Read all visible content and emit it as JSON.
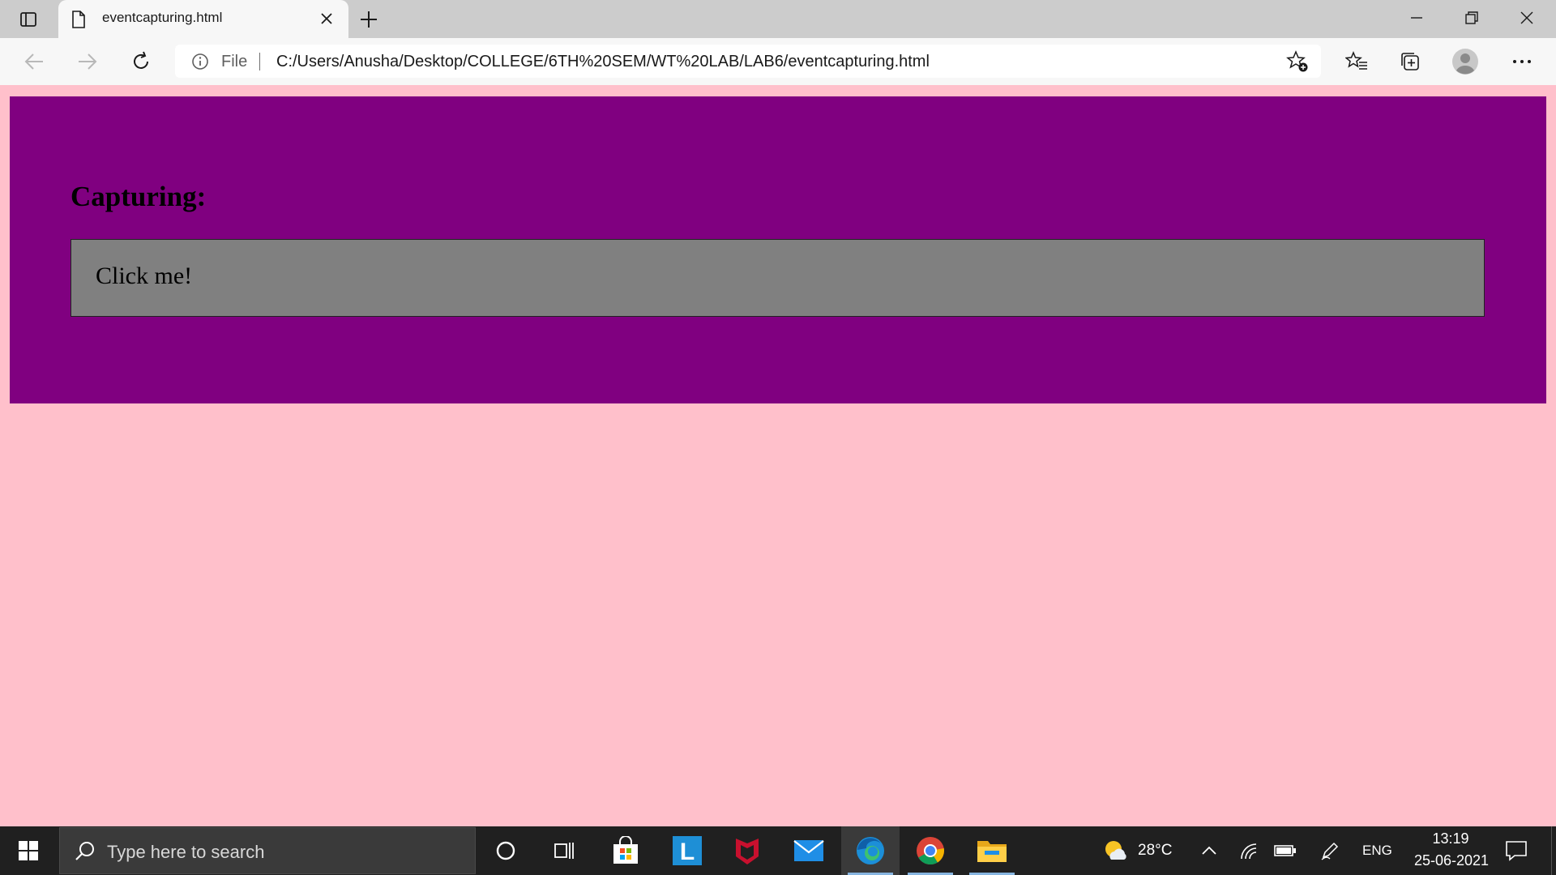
{
  "browser": {
    "tab": {
      "title": "eventcapturing.html"
    },
    "address": {
      "scheme_label": "File",
      "url": "C:/Users/Anusha/Desktop/COLLEGE/6TH%20SEM/WT%20LAB/LAB6/eventcapturing.html"
    }
  },
  "page": {
    "heading": "Capturing:",
    "click_box_text": "Click me!",
    "colors": {
      "background": "#ffc0cb",
      "outer_box": "#800080",
      "click_box": "#808080"
    }
  },
  "taskbar": {
    "search_placeholder": "Type here to search",
    "apps": [
      "cortana-icon",
      "task-view-icon",
      "microsoft-store-icon",
      "l-app-icon",
      "mcafee-icon",
      "mail-icon",
      "edge-icon",
      "chrome-icon",
      "file-explorer-icon"
    ],
    "weather": {
      "temperature": "28°C"
    },
    "language": "ENG",
    "clock": {
      "time": "13:19",
      "date": "25-06-2021"
    }
  }
}
